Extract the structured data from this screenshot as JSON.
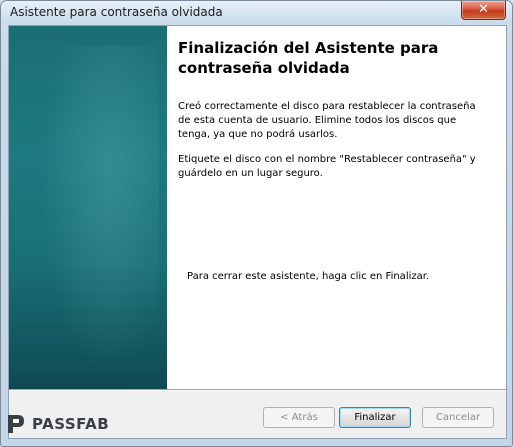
{
  "window": {
    "title": "Asistente para contraseña olvidada",
    "close_label": "✕"
  },
  "content": {
    "heading": "Finalización del Asistente para contraseña olvidada",
    "paragraph1": "Creó correctamente el disco para restablecer la contraseña de esta cuenta de usuario. Elimine todos los discos que tenga, ya que no podrá usarlos.",
    "paragraph2": "Etiquete el disco con el nombre \"Restablecer contraseña\" y guárdelo en un lugar seguro.",
    "paragraph3": "Para cerrar este asistente, haga clic en Finalizar."
  },
  "buttons": {
    "back": "< Atrás",
    "finish": "Finalizar",
    "cancel": "Cancelar"
  },
  "brand": {
    "name": "PASSFAB",
    "icon": "passfab-logo-icon"
  },
  "colors": {
    "side_panel": "#1b6e73",
    "close_button": "#c23a1f"
  }
}
